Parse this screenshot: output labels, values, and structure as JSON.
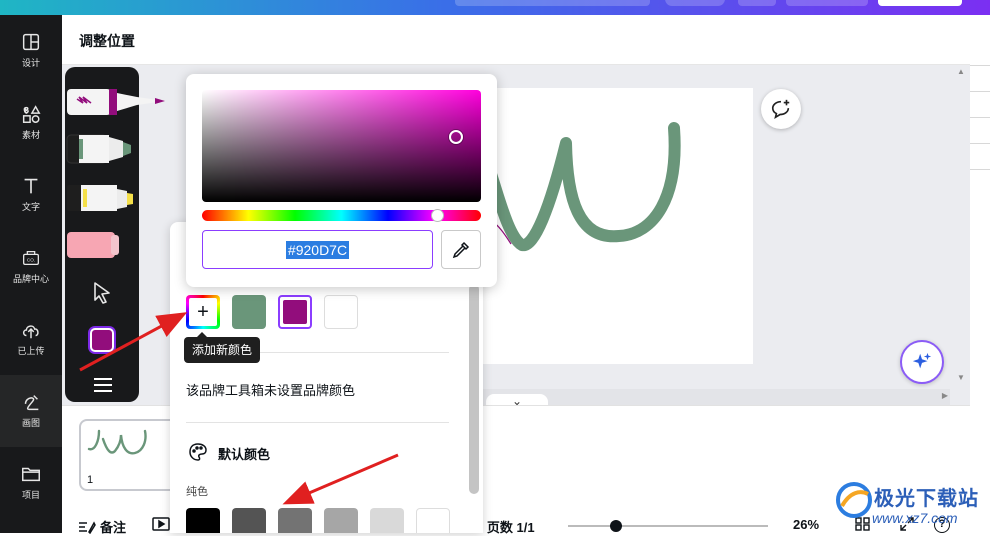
{
  "sidebar": {
    "items": [
      {
        "label": "设计",
        "icon": "layout-icon"
      },
      {
        "label": "素材",
        "icon": "shapes-icon"
      },
      {
        "label": "文字",
        "icon": "text-icon"
      },
      {
        "label": "品牌中心",
        "icon": "brand-kit-icon",
        "badge": "CO."
      },
      {
        "label": "已上传",
        "icon": "upload-cloud-icon"
      },
      {
        "label": "画图",
        "icon": "draw-icon",
        "active": true
      },
      {
        "label": "项目",
        "icon": "folder-icon"
      }
    ]
  },
  "panel": {
    "title": "调整位置"
  },
  "draw_toolbar": {
    "tools": [
      "pen",
      "marker",
      "highlighter",
      "eraser",
      "select"
    ],
    "selected_color": "#920D7C"
  },
  "color_picker": {
    "hex_value": "#920D7C",
    "hue_color": "#ff00dd"
  },
  "color_panel": {
    "document_colors": [
      "#6a967a",
      "#920d7c",
      "#ffffff"
    ],
    "add_color_tooltip": "添加新颜色",
    "brand_message": "该品牌工具箱未设置品牌颜色",
    "default_colors_title": "默认颜色",
    "solid_label": "纯色",
    "solid_colors": [
      "#000000",
      "#545454",
      "#737373",
      "#a6a6a6",
      "#d9d9d9",
      "#ffffff"
    ]
  },
  "canvas": {
    "stroke_color": "#6a967a"
  },
  "thumbnail": {
    "page_number": "1"
  },
  "status_bar": {
    "notes_label": "备注",
    "pages_label": "页数 1/1",
    "zoom_percent": 26,
    "zoom_label": "26%",
    "help": "?"
  },
  "watermark": {
    "brand": "极光下载站",
    "url": "www.xz7.com"
  },
  "colors": {
    "accent": "#8b3dff",
    "sidebar_bg": "#18191b",
    "arrow_red": "#e02020"
  }
}
